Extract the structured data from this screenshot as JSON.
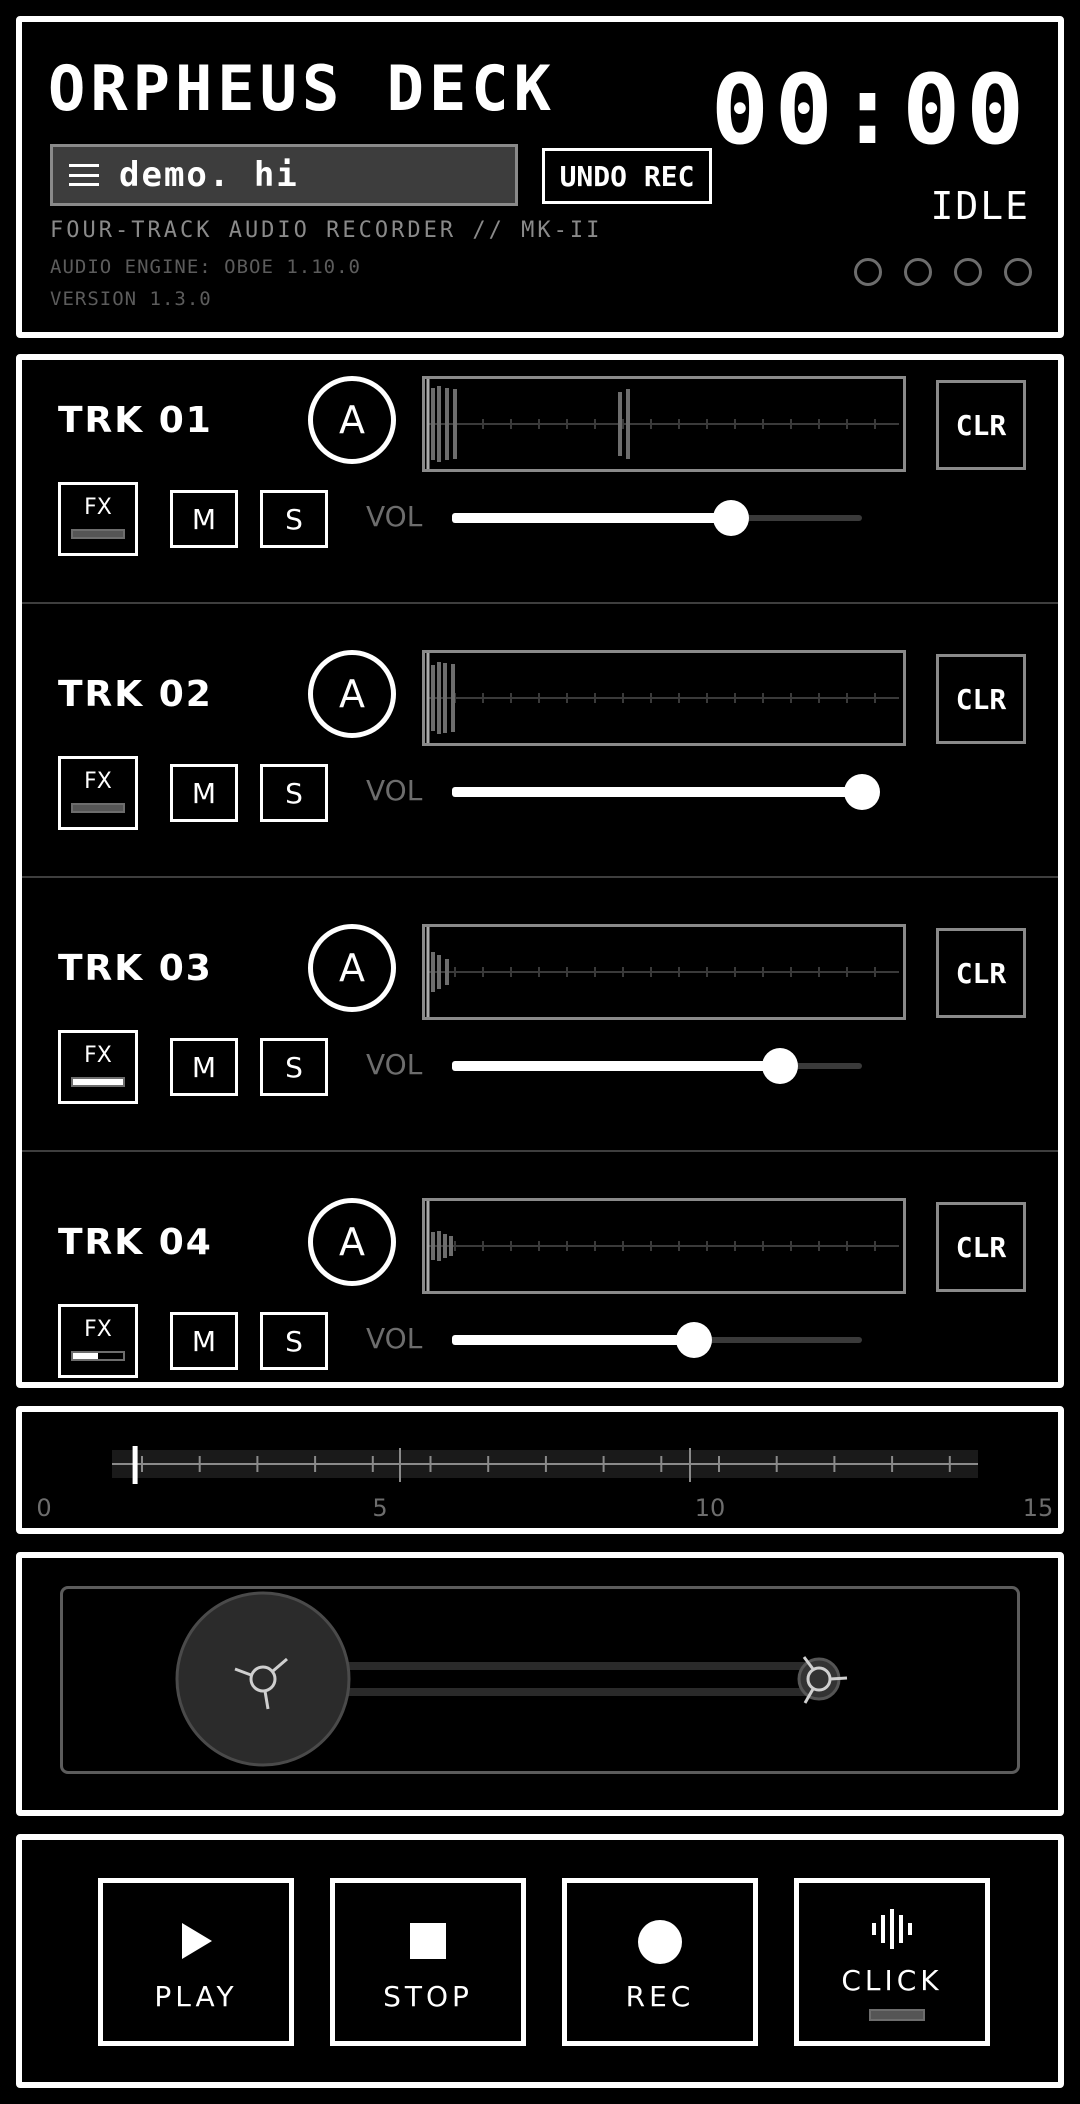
{
  "header": {
    "title": "ORPHEUS DECK",
    "file_name": "demo. hi",
    "undo_label": "UNDO REC",
    "subtitle": "FOUR-TRACK AUDIO RECORDER // MK-II",
    "engine": "AUDIO ENGINE: OBOE 1.10.0",
    "version": "VERSION 1.3.0",
    "timer": "00:00",
    "status": "IDLE"
  },
  "tracks": [
    {
      "name": "TRK 01",
      "arm_label": "A",
      "clear_label": "CLR",
      "fx_label": "FX",
      "mute_label": "M",
      "solo_label": "S",
      "vol_label": "VOL",
      "volume": 0.68,
      "fx_level": 0.0
    },
    {
      "name": "TRK 02",
      "arm_label": "A",
      "clear_label": "CLR",
      "fx_label": "FX",
      "mute_label": "M",
      "solo_label": "S",
      "vol_label": "VOL",
      "volume": 1.0,
      "fx_level": 0.0
    },
    {
      "name": "TRK 03",
      "arm_label": "A",
      "clear_label": "CLR",
      "fx_label": "FX",
      "mute_label": "M",
      "solo_label": "S",
      "vol_label": "VOL",
      "volume": 0.8,
      "fx_level": 1.0
    },
    {
      "name": "TRK 04",
      "arm_label": "A",
      "clear_label": "CLR",
      "fx_label": "FX",
      "mute_label": "M",
      "solo_label": "S",
      "vol_label": "VOL",
      "volume": 0.59,
      "fx_level": 0.5
    }
  ],
  "timeline": {
    "ticks": [
      "0",
      "5",
      "10",
      "15"
    ],
    "position": 0.4
  },
  "transport": {
    "play_label": "PLAY",
    "stop_label": "STOP",
    "rec_label": "REC",
    "click_label": "CLICK"
  },
  "colors": {
    "background": "#000000",
    "foreground": "#ffffff",
    "muted": "#8a8a8a",
    "dim": "#5c5c5c"
  },
  "icons": {
    "menu": "menu-icon",
    "play": "play-icon",
    "stop": "stop-icon",
    "rec": "record-icon",
    "click": "metronome-wave-icon"
  }
}
